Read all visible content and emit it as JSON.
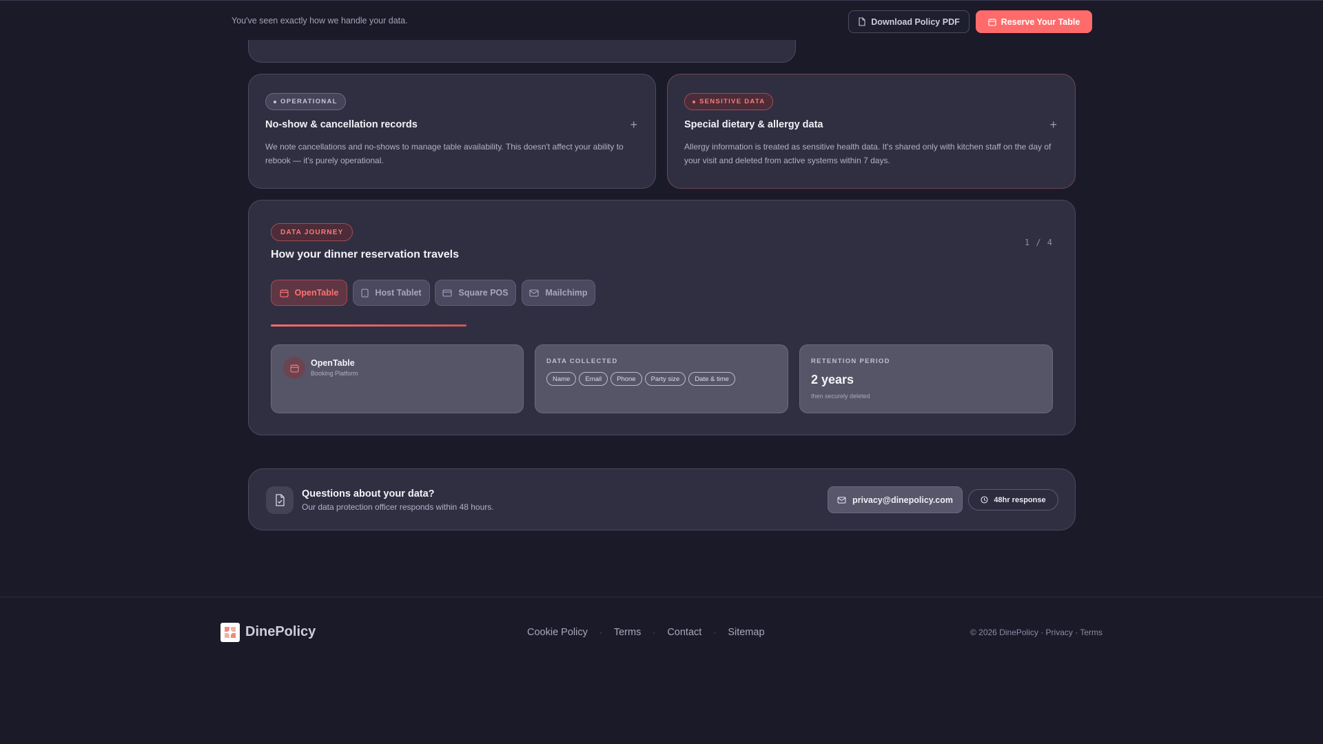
{
  "topbar": {
    "text": "You've seen exactly how we handle your data.",
    "download_label": "Download Policy PDF",
    "reserve_label": "Reserve Your Table"
  },
  "cards": [
    {
      "badge": "OPERATIONAL",
      "title": "No-show & cancellation records",
      "description": "We note cancellations and no-shows to manage table availability. This doesn't affect your ability to rebook — it's purely operational.",
      "toggle": "+"
    },
    {
      "badge": "SENSITIVE DATA",
      "title": "Special dietary & allergy data",
      "description": "Allergy information is treated as sensitive health data. It's shared only with kitchen staff on the day of your visit and deleted from active systems within 7 days.",
      "toggle": "+"
    }
  ],
  "journey": {
    "badge": "DATA JOURNEY",
    "title": "How your dinner reservation travels",
    "counter": "1 / 4",
    "progress": 0.25,
    "tabs": [
      {
        "label": "OpenTable",
        "icon": "calendar-icon",
        "active": true
      },
      {
        "label": "Host Tablet",
        "icon": "tablet-icon",
        "active": false
      },
      {
        "label": "Square POS",
        "icon": "credit-card-icon",
        "active": false
      },
      {
        "label": "Mailchimp",
        "icon": "mail-icon",
        "active": false
      }
    ],
    "service": {
      "name": "OpenTable",
      "type": "Booking Platform"
    },
    "data_collected": {
      "label": "DATA COLLECTED",
      "items": [
        "Name",
        "Email",
        "Phone",
        "Party size",
        "Date & time"
      ]
    },
    "retention": {
      "label": "RETENTION PERIOD",
      "value": "2 years",
      "note": "then securely deleted"
    }
  },
  "contact": {
    "title": "Questions about your data?",
    "subtitle": "Our data protection officer responds within 48 hours.",
    "email": "privacy@dinepolicy.com",
    "response": "48hr response"
  },
  "footer": {
    "brand": "DinePolicy",
    "links": [
      "Cookie Policy",
      "Terms",
      "Contact",
      "Sitemap"
    ],
    "separator": "·",
    "copyright": "© 2026 DinePolicy · Privacy · Terms"
  },
  "colors": {
    "background": "#1b1a29",
    "card": "#302f41",
    "accent": "#ff6b6b"
  }
}
